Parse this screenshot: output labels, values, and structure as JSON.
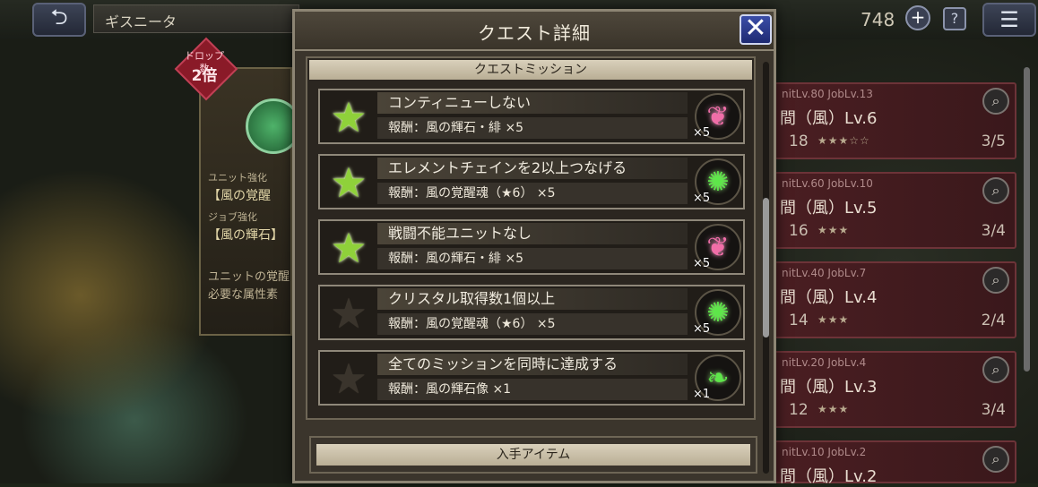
{
  "header": {
    "title": "ギスニータ",
    "gem_count": "748",
    "back_icon": "return-arrow-icon",
    "menu_icon": "hamburger-icon"
  },
  "left_panel": {
    "drop_badge": {
      "label": "ドロップ数",
      "multiplier": "2倍"
    },
    "unit_label": "ユニット強化",
    "unit_item": "【風の覚醒",
    "job_label": "ジョブ強化",
    "job_item": "【風の輝石】",
    "desc1": "ユニットの覚醒",
    "desc2": "必要な属性素"
  },
  "quest_list": [
    {
      "lv": "nitLv.80 JobLv.13",
      "name": "間（風）Lv.6",
      "stamina": "18",
      "stars": "★★★☆☆",
      "progress": "3/5"
    },
    {
      "lv": "nitLv.60 JobLv.10",
      "name": "間（風）Lv.5",
      "stamina": "16",
      "stars": "★★★",
      "progress": "3/4"
    },
    {
      "lv": "nitLv.40 JobLv.7",
      "name": "間（風）Lv.4",
      "stamina": "14",
      "stars": "★★★",
      "progress": "2/4"
    },
    {
      "lv": "nitLv.20 JobLv.4",
      "name": "間（風）Lv.3",
      "stamina": "12",
      "stars": "★★★",
      "progress": "3/4"
    },
    {
      "lv": "nitLv.10 JobLv.2",
      "name": "間（風）Lv.2",
      "stamina": "",
      "stars": "",
      "progress": ""
    }
  ],
  "modal": {
    "title": "クエスト詳細",
    "close_label": "✕",
    "missions_header": "クエストミッション",
    "items_header": "入手アイテム",
    "missions": [
      {
        "title": "コンティニューしない",
        "reward": "報酬：風の輝石・緋 ×5",
        "done": true,
        "item_qty": "×5",
        "item_color": "pink"
      },
      {
        "title": "エレメントチェインを2以上つなげる",
        "reward": "報酬：風の覚醒魂（★6） ×5",
        "done": true,
        "item_qty": "×5",
        "item_color": "green"
      },
      {
        "title": "戦闘不能ユニットなし",
        "reward": "報酬：風の輝石・緋 ×5",
        "done": true,
        "item_qty": "×5",
        "item_color": "pink"
      },
      {
        "title": "クリスタル取得数1個以上",
        "reward": "報酬：風の覚醒魂（★6） ×5",
        "done": false,
        "item_qty": "×5",
        "item_color": "green"
      },
      {
        "title": "全てのミッションを同時に達成する",
        "reward": "報酬：風の輝石像 ×1",
        "done": false,
        "item_qty": "×1",
        "item_color": "green"
      }
    ]
  }
}
